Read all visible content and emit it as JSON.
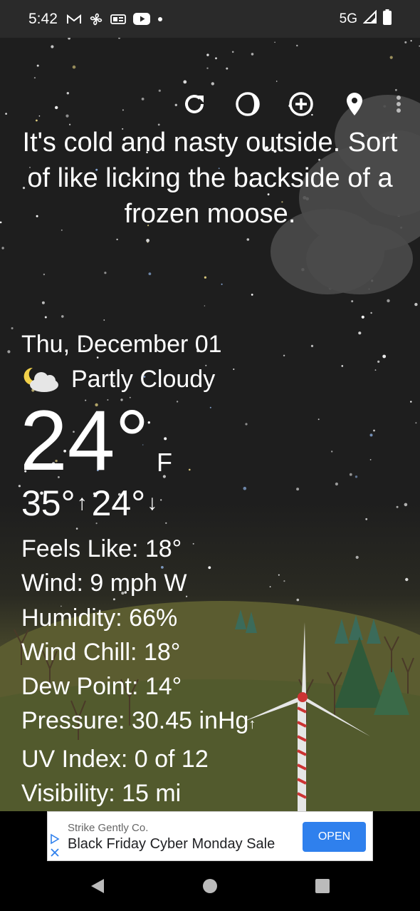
{
  "status_bar": {
    "time": "5:42",
    "network": "5G",
    "icons": [
      "gmail-icon",
      "fan-icon",
      "news-icon",
      "youtube-icon",
      "dot-icon",
      "signal-icon",
      "battery-icon"
    ]
  },
  "toolbar": {
    "icons": [
      "refresh-icon",
      "moon-phase-icon",
      "add-location-icon",
      "location-pin-icon",
      "more-vert-icon"
    ]
  },
  "quote": "It's cold and nasty outside. Sort of like licking the backside of a frozen moose.",
  "weather": {
    "date": "Thu, December 01",
    "condition": "Partly Cloudy",
    "condition_icon": "partly-cloudy-night-icon",
    "temperature": "24°",
    "unit": "F",
    "high": "35°",
    "low": "24°"
  },
  "details": [
    {
      "label": "Feels Like:",
      "value": "18°"
    },
    {
      "label": "Wind:",
      "value": "9 mph W"
    },
    {
      "label": "Humidity:",
      "value": "66%"
    },
    {
      "label": "Wind Chill:",
      "value": "18°"
    },
    {
      "label": "Dew Point:",
      "value": "14°"
    },
    {
      "label": "Pressure:",
      "value": "30.45 inHg",
      "trend": "↑"
    },
    {
      "label": "UV Index:",
      "value": "0 of 12"
    },
    {
      "label": "Visibility:",
      "value": "15 mi"
    }
  ],
  "ad": {
    "advertiser": "Strike Gently Co.",
    "title": "Black Friday Cyber Monday Sale",
    "button": "OPEN"
  },
  "colors": {
    "sky": "#1e1e1e",
    "ground": "#5b5c30",
    "ad_button": "#2f80ed"
  }
}
